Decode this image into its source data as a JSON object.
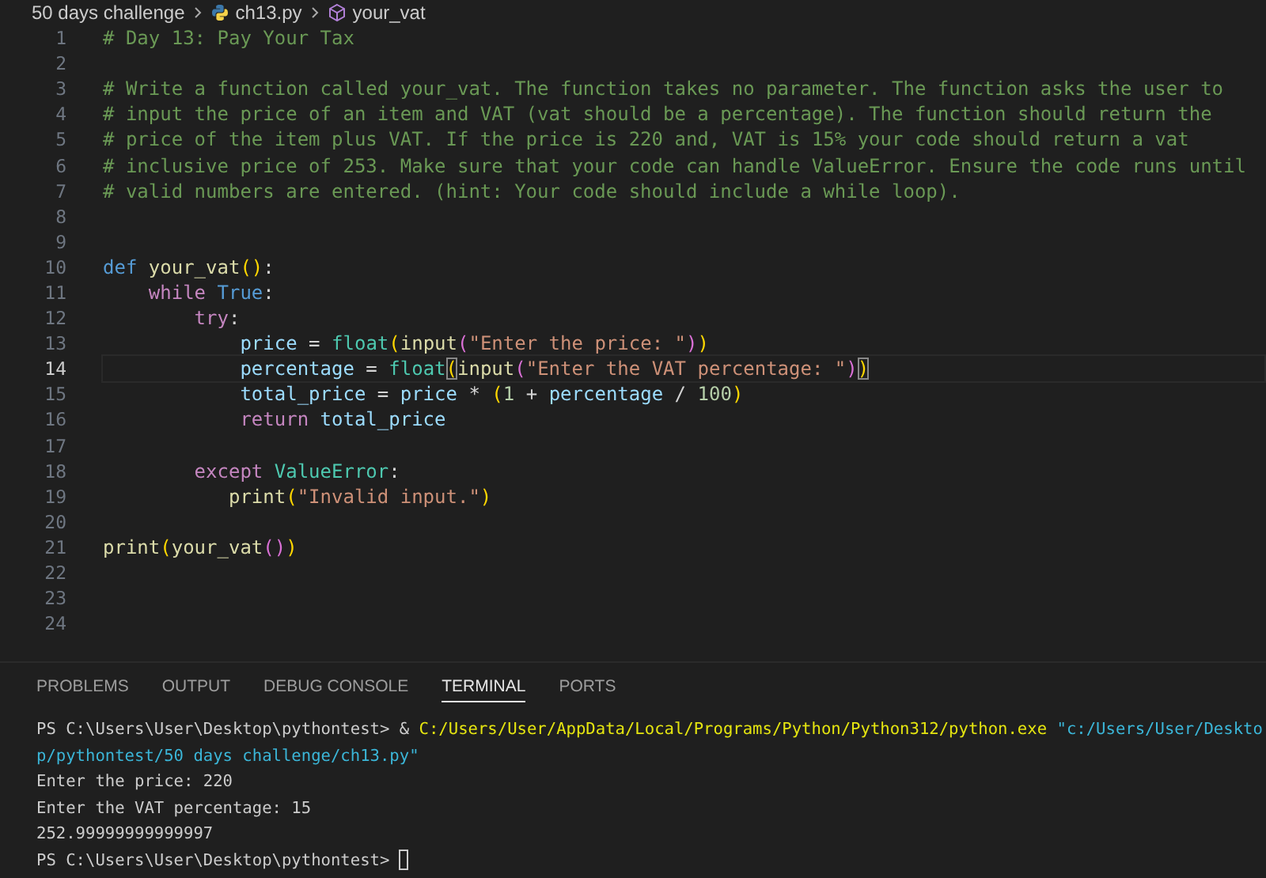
{
  "breadcrumb": [
    {
      "kind": "folder",
      "label": "50 days challenge"
    },
    {
      "kind": "python-file",
      "label": "ch13.py"
    },
    {
      "kind": "symbol",
      "label": "your_vat"
    }
  ],
  "editor": {
    "lines": [
      {
        "number": "1",
        "current": false,
        "tokens": [
          {
            "kind": "comment",
            "text": "# Day 13: Pay Your Tax"
          }
        ]
      },
      {
        "number": "2",
        "current": false
      },
      {
        "number": "3",
        "current": false,
        "tokens": [
          {
            "kind": "comment",
            "text": "# Write a function called your_vat. The function takes no parameter. The function asks the user to"
          }
        ]
      },
      {
        "number": "4",
        "current": false,
        "tokens": [
          {
            "kind": "comment",
            "text": "# input the price of an item and VAT (vat should be a percentage). The function should return the"
          }
        ]
      },
      {
        "number": "5",
        "current": false,
        "tokens": [
          {
            "kind": "comment",
            "text": "# price of the item plus VAT. If the price is 220 and, VAT is 15% your code should return a vat"
          }
        ]
      },
      {
        "number": "6",
        "current": false,
        "tokens": [
          {
            "kind": "comment",
            "text": "# inclusive price of 253. Make sure that your code can handle ValueError. Ensure the code runs until"
          }
        ]
      },
      {
        "number": "7",
        "current": false,
        "tokens": [
          {
            "kind": "comment",
            "text": "# valid numbers are entered. (hint: Your code should include a while loop)."
          }
        ]
      },
      {
        "number": "8",
        "current": false
      },
      {
        "number": "9",
        "current": false
      },
      {
        "number": "10",
        "current": false,
        "tokens": [
          {
            "kind": "storage",
            "text": "def "
          },
          {
            "kind": "function",
            "text": "your_vat"
          },
          {
            "kind": "bracket-1",
            "text": "()"
          },
          {
            "kind": "plain",
            "text": ":"
          }
        ]
      },
      {
        "number": "11",
        "current": false,
        "tokens": [
          {
            "kind": "control",
            "text": "    while "
          },
          {
            "kind": "storage",
            "text": "True"
          },
          {
            "kind": "plain",
            "text": ":"
          }
        ]
      },
      {
        "number": "12",
        "current": false,
        "tokens": [
          {
            "kind": "control",
            "text": "        try"
          },
          {
            "kind": "plain",
            "text": ":"
          }
        ]
      },
      {
        "number": "13",
        "current": false,
        "tokens": [
          {
            "kind": "variable",
            "text": "            price"
          },
          {
            "kind": "plain",
            "text": " = "
          },
          {
            "kind": "class",
            "text": "float"
          },
          {
            "kind": "bracket-1",
            "text": "("
          },
          {
            "kind": "function",
            "text": "input"
          },
          {
            "kind": "bracket-2",
            "text": "("
          },
          {
            "kind": "string",
            "text": "\"Enter the price: \""
          },
          {
            "kind": "bracket-2",
            "text": ")"
          },
          {
            "kind": "bracket-1",
            "text": ")"
          }
        ]
      },
      {
        "number": "14",
        "current": true,
        "tokens": [
          {
            "kind": "variable",
            "text": "            percentage"
          },
          {
            "kind": "plain",
            "text": " = "
          },
          {
            "kind": "class",
            "text": "float"
          },
          {
            "kind": "bracket-match",
            "text": "("
          },
          {
            "kind": "function",
            "text": "input"
          },
          {
            "kind": "bracket-2",
            "text": "("
          },
          {
            "kind": "string",
            "text": "\"Enter the VAT percentage: \""
          },
          {
            "kind": "bracket-2",
            "text": ")"
          },
          {
            "kind": "bracket-match",
            "text": ")"
          }
        ]
      },
      {
        "number": "15",
        "current": false,
        "tokens": [
          {
            "kind": "variable",
            "text": "            total_price"
          },
          {
            "kind": "plain",
            "text": " = "
          },
          {
            "kind": "variable",
            "text": "price"
          },
          {
            "kind": "plain",
            "text": " * "
          },
          {
            "kind": "bracket-1",
            "text": "("
          },
          {
            "kind": "number",
            "text": "1"
          },
          {
            "kind": "plain",
            "text": " + "
          },
          {
            "kind": "variable",
            "text": "percentage"
          },
          {
            "kind": "plain",
            "text": " / "
          },
          {
            "kind": "number",
            "text": "100"
          },
          {
            "kind": "bracket-1",
            "text": ")"
          }
        ]
      },
      {
        "number": "16",
        "current": false,
        "tokens": [
          {
            "kind": "control",
            "text": "            return "
          },
          {
            "kind": "variable",
            "text": "total_price"
          }
        ]
      },
      {
        "number": "17",
        "current": false
      },
      {
        "number": "18",
        "current": false,
        "tokens": [
          {
            "kind": "control",
            "text": "        except "
          },
          {
            "kind": "class",
            "text": "ValueError"
          },
          {
            "kind": "plain",
            "text": ":"
          }
        ]
      },
      {
        "number": "19",
        "current": false,
        "tokens": [
          {
            "kind": "function",
            "text": "           print"
          },
          {
            "kind": "bracket-1",
            "text": "("
          },
          {
            "kind": "string",
            "text": "\"Invalid input.\""
          },
          {
            "kind": "bracket-1",
            "text": ")"
          }
        ]
      },
      {
        "number": "20",
        "current": false
      },
      {
        "number": "21",
        "current": false,
        "tokens": [
          {
            "kind": "function",
            "text": "print"
          },
          {
            "kind": "bracket-1",
            "text": "("
          },
          {
            "kind": "function",
            "text": "your_vat"
          },
          {
            "kind": "bracket-2",
            "text": "()"
          },
          {
            "kind": "bracket-1",
            "text": ")"
          }
        ]
      },
      {
        "number": "22",
        "current": false
      },
      {
        "number": "23",
        "current": false
      },
      {
        "number": "24",
        "current": false
      }
    ]
  },
  "panel": {
    "tabs": [
      {
        "label": "PROBLEMS",
        "selected": false
      },
      {
        "label": "OUTPUT",
        "selected": false
      },
      {
        "label": "DEBUG CONSOLE",
        "selected": false
      },
      {
        "label": "TERMINAL",
        "selected": true
      },
      {
        "label": "PORTS",
        "selected": false
      }
    ],
    "terminal": {
      "lines": [
        {
          "cursor": false,
          "segments": [
            {
              "kind": "text",
              "text": "PS C:\\Users\\User\\Desktop\\pythontest> & "
            },
            {
              "kind": "command",
              "text": "C:/Users/User/AppData/Local/Programs/Python/Python312/python.exe"
            },
            {
              "kind": "string",
              "text": " \"c:/Users/User/Deskto"
            }
          ]
        },
        {
          "cursor": false,
          "segments": [
            {
              "kind": "string",
              "text": "p/pythontest/50 days challenge/ch13.py\""
            }
          ]
        },
        {
          "cursor": false,
          "segments": [
            {
              "kind": "text",
              "text": "Enter the price: 220"
            }
          ]
        },
        {
          "cursor": false,
          "segments": [
            {
              "kind": "text",
              "text": "Enter the VAT percentage: 15"
            }
          ]
        },
        {
          "cursor": false,
          "segments": [
            {
              "kind": "text",
              "text": "252.99999999999997"
            }
          ]
        },
        {
          "cursor": true,
          "segments": [
            {
              "kind": "text",
              "text": "PS C:\\Users\\User\\Desktop\\pythontest> "
            }
          ]
        }
      ]
    }
  }
}
